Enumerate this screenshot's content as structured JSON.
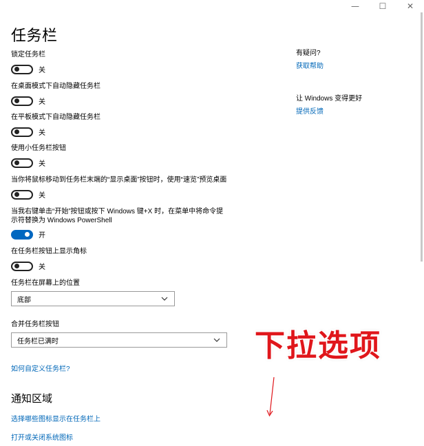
{
  "window": {
    "minimize_icon": "minimize-icon",
    "maximize_icon": "maximize-icon",
    "close_icon": "close-icon",
    "min_glyph": "—",
    "max_glyph": "☐",
    "close_glyph": "✕"
  },
  "page": {
    "title": "任务栏"
  },
  "settings": [
    {
      "label": "锁定任务栏",
      "state": "关",
      "on": false
    },
    {
      "label": "在桌面模式下自动隐藏任务栏",
      "state": "关",
      "on": false
    },
    {
      "label": "在平板模式下自动隐藏任务栏",
      "state": "关",
      "on": false
    },
    {
      "label": "使用小任务栏按钮",
      "state": "关",
      "on": false
    },
    {
      "label": "当你将鼠标移动到任务栏末端的“显示桌面”按钮时，使用“速览”预览桌面",
      "state": "关",
      "on": false
    },
    {
      "label_line1": "当我右键单击“开始”按钮或按下 Windows 键+X 时，在菜单中将命令提",
      "label_line2": "示符替换为 Windows PowerShell",
      "state": "开",
      "on": true
    },
    {
      "label": "在任务栏按钮上显示角标",
      "state": "关",
      "on": false
    }
  ],
  "position": {
    "label": "任务栏在屏幕上的位置",
    "value": "底部"
  },
  "combine": {
    "label": "合并任务栏按钮",
    "value": "任务栏已满时"
  },
  "customize_link": "如何自定义任务栏?",
  "notification": {
    "title": "通知区域",
    "link1": "选择哪些图标显示在任务栏上",
    "link2": "打开或关闭系统图标"
  },
  "sidebar": {
    "question": "有疑问?",
    "help_link": "获取帮助",
    "improve": "让 Windows 变得更好",
    "feedback_link": "提供反馈"
  },
  "annotation": {
    "text": "下拉选项",
    "color": "#e0161b"
  }
}
